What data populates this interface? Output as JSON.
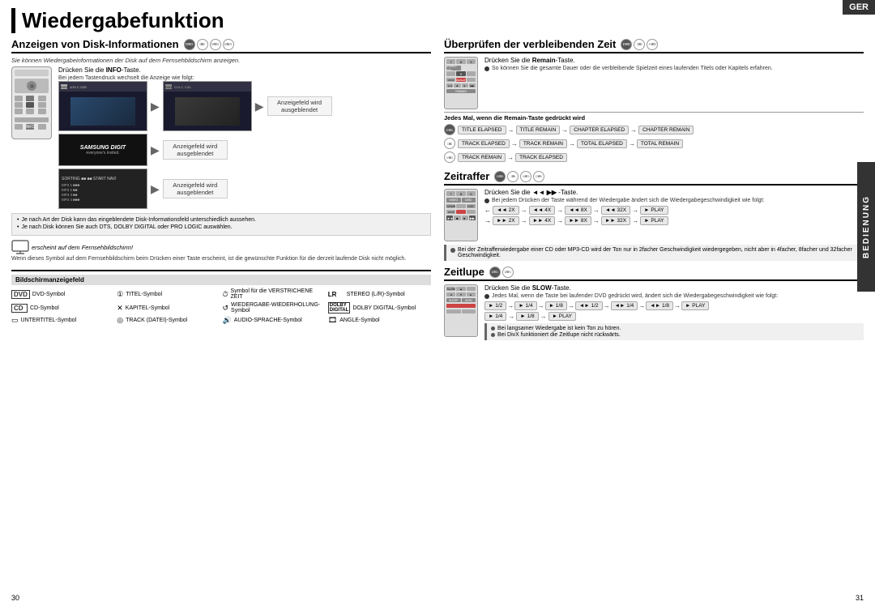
{
  "page": {
    "title": "Wiedergabefunktion",
    "lang_badge": "GER",
    "page_left": "30",
    "page_right": "31"
  },
  "left_section": {
    "title": "Anzeigen von Disk-Informationen",
    "subtitle": "Sie können Wiedergabeinformationen der Disk auf dem Fernsehbildschirm anzeigen.",
    "instruction": "Drücken Sie die INFO-Taste.",
    "instruction_key": "INFO",
    "bullet1": "Bei jedem Tastendruck wechselt die Anzeige wie folgt:",
    "label1": "Anzeigefeld wird ausgeblendet",
    "label2": "Anzeigefeld wird ausgeblendet",
    "label3": "Anzeigefeld wird ausgeblendet",
    "note1": "Je nach Art der Disk kann das eingeblendete Disk-Informationsfeld unterschiedlich aussehen.",
    "note2": "Je nach Disk können Sie auch DTS, DOLBY DIGITAL oder PRO LOGIC auswählen.",
    "tv_note": "erscheint auf dem Fernsehbildschirm!",
    "tv_desc": "Wenn dieses Symbol auf dem Fernsehbildschirm beim Drücken einer Taste erscheint, ist die gewünschte Funktion für die derzeit laufende Disk nicht möglich."
  },
  "legend": {
    "title": "Bildschirmanzeigefeld",
    "items": [
      {
        "badge": "DVD",
        "desc": "DVD-Symbol"
      },
      {
        "badge": "①",
        "desc": "TITEL-Symbol"
      },
      {
        "badge": "⏱",
        "desc": "Symbol für die VERSTRICHENE ZEIT"
      },
      {
        "badge": "LR",
        "desc": "STEREO (L/R)-Symbol"
      },
      {
        "badge": "CD",
        "desc": "CD-Symbol"
      },
      {
        "badge": "⊕",
        "desc": "KAPITEL-Symbol"
      },
      {
        "badge": "↺",
        "desc": "WIEDERGABE-WIEDERHOLUNG-Symbol"
      },
      {
        "badge": "DOLBY",
        "desc": "DOLBY DIGITAL-Symbol"
      },
      {
        "badge": "▭",
        "desc": "UNTERTITEL-Symbol"
      },
      {
        "badge": "◎",
        "desc": "TRACK (DATEI)-Symbol"
      },
      {
        "badge": "🔊",
        "desc": "AUDIO-SPRACHE-Symbol"
      },
      {
        "badge": "🎞",
        "desc": "ANGLE-Symbol"
      }
    ]
  },
  "right_top": {
    "title": "Überprüfen der verbleibenden Zeit",
    "instruction": "Drücken Sie die Remain-Taste.",
    "instruction_key": "Remain",
    "desc": "So können Sie die gesamte Dauer oder die verbleibende Spielzeit eines laufenden Titels oder Kapitels erfahren.",
    "note_header": "Jedes Mal, wenn die Remain-Taste gedrückt wird",
    "dvd_row": "TITLE ELAPSED → TITLE REMAIN → CHAPTER ELAPSED → CHAPTER REMAIN",
    "cd_row": "TRACK ELAPSED → TRACK REMAIN → TOTAL ELAPSED → TOTAL REMAIN",
    "svcd_row": "TRACK REMAIN → TRACK ELAPSED"
  },
  "zeitraffer": {
    "title": "Zeitraffer",
    "instruction": "Drücken Sie die ◄◄ ►► -Taste.",
    "instruction_key": "◄◄ ►►",
    "desc": "Bei jedem Drücken der Taste während der Wiedergabe ändert sich die Wiedergabegeschwindigkeit wie folgt:",
    "row1": "◄◄ 2X → ◄◄ 4X → ◄◄ 8X → ◄◄ 32X → ► PLAY",
    "row2": "►► 2X → ►► 4X → ►► 8X → ►► 32X → ► PLAY",
    "note": "Bei der Zeitrafferwiedergabe einer CD oder MP3-CD wird der Ton nur in 2facher Geschwindigkeit wiedergegeben, nicht aber in 4facher, 8facher und 32facher Geschwindigkeit."
  },
  "zeitlupe": {
    "title": "Zeitlupe",
    "instruction": "Drücken Sie die SLOW-Taste.",
    "instruction_key": "SLOW",
    "desc": "Jedes Mal, wenn die Taste bei laufender DVD gedrückt wird, ändert sich die Wiedergabegeschwindigkeit wie folgt:",
    "row1": "► 1/2 → ► 1/4 → ► 1/8 → ◄►1/2 → ◄►1/4 → ◄►1/8 → ► PLAY",
    "row2": "► 1/4 → ► 1/8 → ► PLAY",
    "note1": "Bei langsamer Wiedergabe ist kein Ton zu hören.",
    "note2": "Bei DivX funktioniert die Zeitlupe nicht rückwärts."
  },
  "bedienung_label": "BEDIENUNG"
}
